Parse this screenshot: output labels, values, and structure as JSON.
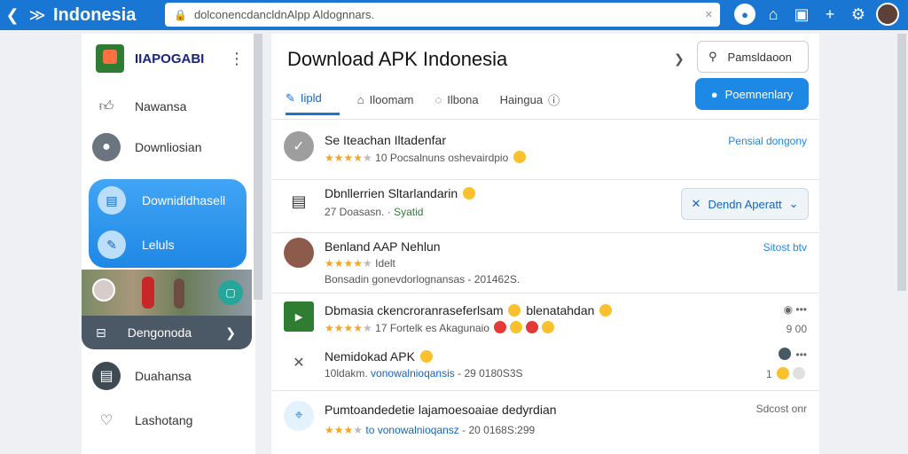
{
  "topbar": {
    "title": "Indonesia",
    "url": "dolconencdancldnAlpp Aldognnars.",
    "icons": [
      "back-icon",
      "forward-icon",
      "lock-icon",
      "mic-icon",
      "home-icon",
      "tab-icon",
      "plus-icon",
      "settings-icon",
      "avatar"
    ]
  },
  "sidebar": {
    "brand": "IIAPOGABI",
    "items": [
      {
        "label": "Nawansa"
      },
      {
        "label": "Downliosian"
      },
      {
        "label": "Downidldhasell"
      },
      {
        "label": "Leluls"
      },
      {
        "label": "Dengonoda"
      },
      {
        "label": "Duahansa"
      },
      {
        "label": "Lashotang"
      }
    ]
  },
  "main": {
    "title": "Download APK Indonesia",
    "search_label": "Pamsldaoon",
    "primary_button": "Poemnenlary",
    "tabs": [
      {
        "label": "Iipld"
      },
      {
        "label": "Iloomam"
      },
      {
        "label": "Ilbona"
      },
      {
        "label": "Haingua"
      }
    ],
    "rows": [
      {
        "title": "Se Iteachan Iltadenfar",
        "rating": "10",
        "sub": "Pocsalnuns oshevairdpio",
        "right": "Pensial dongony"
      },
      {
        "title": "Dbnllerrien Sltarlandarin",
        "rating": "27 Doasasn.",
        "status": "Syatid",
        "button": "Dendn Aperatt"
      },
      {
        "title": "Benland AAP Nehlun",
        "rating_text": "Idelt",
        "sub": "Bonsadin gonevdorlognansas - 201462S.",
        "right": "Sitost btv"
      },
      {
        "title": "Dbmasia ckencroranraseferlsam",
        "title_suffix": "blenatahdan",
        "rating": "17 Fortelk",
        "sub": "es Akagunaio",
        "right": "9 00"
      },
      {
        "title": "Nemidokad APK",
        "sub_a": "10ldakm.",
        "sub_link": "vonowalnioqansis",
        "sub_b": "- 29 0180S3S",
        "right": "1"
      },
      {
        "title": "Pumtoandedetie lajamoesoaiae dedyrdian",
        "sub_link": "to vonowalnioqansz",
        "sub_b": "- 20 0168S:299",
        "right": "Sdcost onr"
      }
    ]
  },
  "colors": {
    "topbar": "#1976d2",
    "accent": "#1e88e5",
    "star": "#f5a623",
    "sidebar_dark": "#4b5865"
  }
}
